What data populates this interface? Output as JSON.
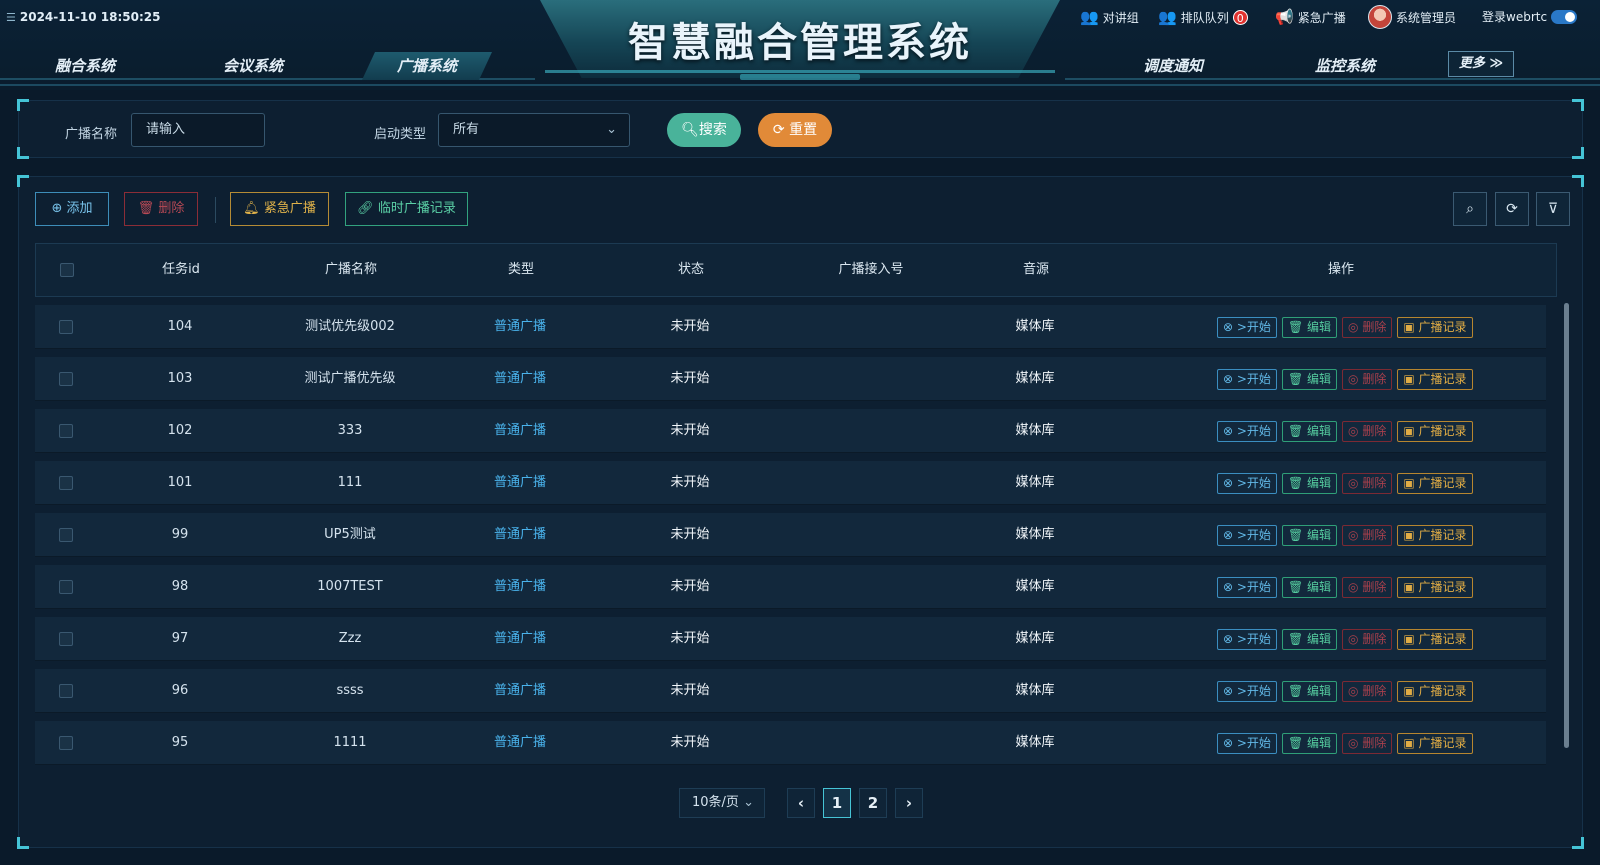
{
  "header": {
    "datetime": "2024-11-10 18:50:25",
    "system_title": "智慧融合管理系统",
    "nav_left": [
      "融合系统",
      "会议系统",
      "广播系统"
    ],
    "nav_right": [
      "调度通知",
      "监控系统"
    ],
    "active_nav": "广播系统",
    "more_label": "更多",
    "intercom_label": "对讲组",
    "queue_label": "排队队列",
    "queue_count": "0",
    "emergency_label": "紧急广播",
    "user_label": "系统管理员",
    "login_label": "登录webrtc"
  },
  "filters": {
    "name_label": "广播名称",
    "name_placeholder": "请输入",
    "type_label": "启动类型",
    "type_value": "所有",
    "search_label": "搜索",
    "reset_label": "重置"
  },
  "toolbar": {
    "add_label": "添加",
    "delete_label": "删除",
    "emergency_label": "紧急广播",
    "temp_record_label": "临时广播记录"
  },
  "table": {
    "columns": [
      "任务id",
      "广播名称",
      "类型",
      "状态",
      "广播接入号",
      "音源",
      "操作"
    ],
    "rows": [
      {
        "id": "104",
        "name": "测试优先级002",
        "type": "普通广播",
        "status": "未开始",
        "access": "",
        "source": "媒体库"
      },
      {
        "id": "103",
        "name": "测试广播优先级",
        "type": "普通广播",
        "status": "未开始",
        "access": "",
        "source": "媒体库"
      },
      {
        "id": "102",
        "name": "333",
        "type": "普通广播",
        "status": "未开始",
        "access": "",
        "source": "媒体库"
      },
      {
        "id": "101",
        "name": "111",
        "type": "普通广播",
        "status": "未开始",
        "access": "",
        "source": "媒体库"
      },
      {
        "id": "99",
        "name": "UP5测试",
        "type": "普通广播",
        "status": "未开始",
        "access": "",
        "source": "媒体库"
      },
      {
        "id": "98",
        "name": "1007TEST",
        "type": "普通广播",
        "status": "未开始",
        "access": "",
        "source": "媒体库"
      },
      {
        "id": "97",
        "name": "Zzz",
        "type": "普通广播",
        "status": "未开始",
        "access": "",
        "source": "媒体库"
      },
      {
        "id": "96",
        "name": "ssss",
        "type": "普通广播",
        "status": "未开始",
        "access": "",
        "source": "媒体库"
      },
      {
        "id": "95",
        "name": "1111",
        "type": "普通广播",
        "status": "未开始",
        "access": "",
        "source": "媒体库"
      }
    ],
    "op_labels": {
      "start": ">开始",
      "edit": "编辑",
      "delete": "删除",
      "record": "广播记录"
    }
  },
  "pagination": {
    "page_size": "10条/页",
    "pages": [
      "1",
      "2"
    ],
    "current": "1"
  },
  "colors": {
    "background": "#0a1a2a",
    "accent_cyan": "#45c4d6",
    "search_green": "#49b39a",
    "reset_orange": "#e18a38",
    "link_blue": "#4ab3ec"
  }
}
